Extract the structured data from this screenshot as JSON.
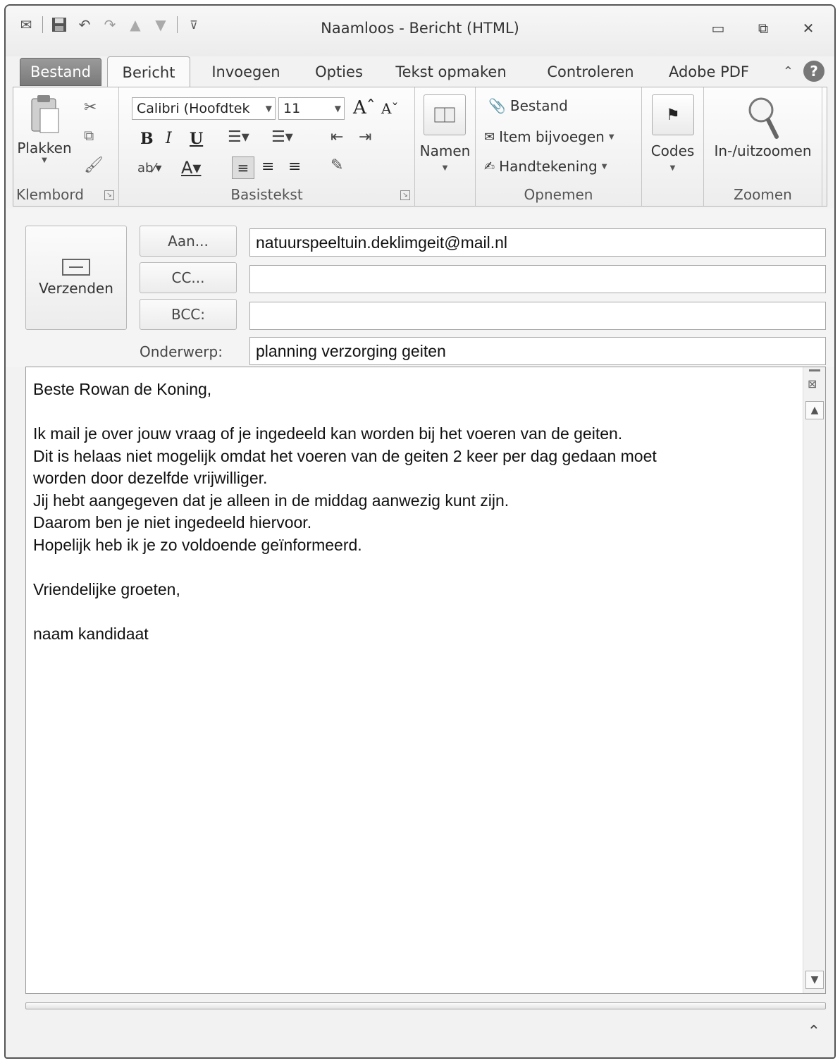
{
  "window": {
    "title": "Naamloos - Bericht (HTML)",
    "minimize_icon": "▭",
    "restore_icon": "⧉",
    "close_icon": "✕"
  },
  "tabs": {
    "file": "Bestand",
    "message": "Bericht",
    "insert": "Invoegen",
    "options": "Opties",
    "format_text": "Tekst opmaken",
    "review": "Controleren",
    "adobe_pdf": "Adobe PDF",
    "help": "?"
  },
  "ribbon": {
    "clipboard": {
      "paste_label": "Plakken",
      "group_label": "Klembord"
    },
    "basic_text": {
      "font_name": "Calibri (Hoofdtek",
      "font_size": "11",
      "group_label": "Basistekst"
    },
    "names": {
      "label": "Namen"
    },
    "include": {
      "file_label": "Bestand",
      "item_label": "Item bijvoegen",
      "signature_label": "Handtekening",
      "group_label": "Opnemen"
    },
    "tags": {
      "label": "Codes"
    },
    "zoom": {
      "label": "In-/uitzoomen",
      "group_label": "Zoomen"
    }
  },
  "header": {
    "send_label": "Verzenden",
    "to_button": "Aan...",
    "cc_button": "CC...",
    "bcc_button": "BCC:",
    "subject_label": "Onderwerp:",
    "to_value": "natuurspeeltuin.deklimgeit@mail.nl",
    "cc_value": "",
    "bcc_value": "",
    "subject_value": "planning verzorging geiten"
  },
  "body": {
    "text": "Beste Rowan de Koning,\n\nIk mail je over jouw vraag of je ingedeeld kan worden bij het voeren van de geiten.\nDit is helaas niet mogelijk omdat het voeren van de geiten 2 keer per dag gedaan moet\nworden door dezelfde vrijwilliger.\nJij hebt aangegeven dat je alleen in de middag aanwezig kunt zijn.\nDaarom ben je niet ingedeeld hiervoor.\nHopelijk heb ik je zo voldoende geïnformeerd.\n\nVriendelijke groeten,\n\nnaam kandidaat"
  }
}
